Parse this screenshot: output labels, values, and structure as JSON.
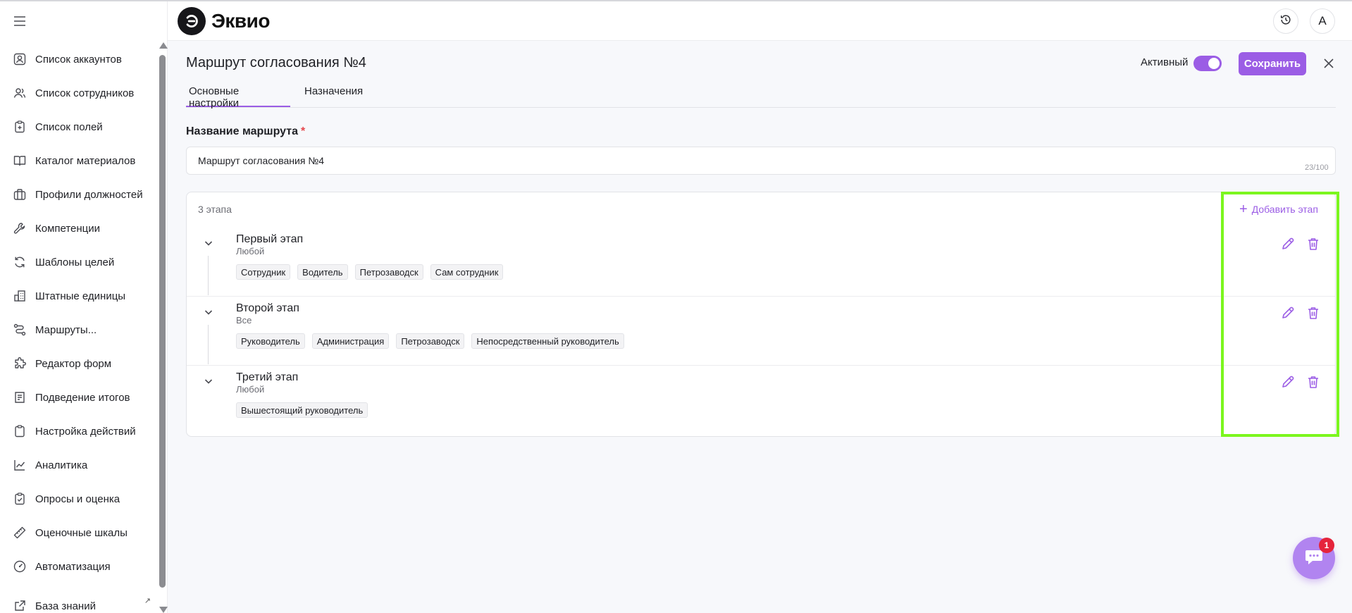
{
  "app": {
    "name": "Эквио"
  },
  "header": {
    "avatar_letter": "А"
  },
  "sidebar": {
    "items": [
      {
        "label": "Список аккаунтов",
        "icon": "account-card-icon"
      },
      {
        "label": "Список сотрудников",
        "icon": "users-icon"
      },
      {
        "label": "Список полей",
        "icon": "clipboard-plus-icon"
      },
      {
        "label": "Каталог материалов",
        "icon": "book-icon"
      },
      {
        "label": "Профили должностей",
        "icon": "briefcase-icon"
      },
      {
        "label": "Компетенции",
        "icon": "wrench-icon"
      },
      {
        "label": "Шаблоны целей",
        "icon": "refresh-icon"
      },
      {
        "label": "Штатные единицы",
        "icon": "buildings-icon"
      },
      {
        "label": "Маршруты...",
        "icon": "route-icon"
      },
      {
        "label": "Редактор форм",
        "icon": "puzzle-icon"
      },
      {
        "label": "Подведение итогов",
        "icon": "document-list-icon"
      },
      {
        "label": "Настройка действий",
        "icon": "clipboard-icon"
      },
      {
        "label": "Аналитика",
        "icon": "chart-line-icon"
      },
      {
        "label": "Опросы и оценка",
        "icon": "clipboard-check-icon"
      },
      {
        "label": "Оценочные шкалы",
        "icon": "ruler-icon"
      },
      {
        "label": "Автоматизация",
        "icon": "gauge-icon"
      },
      {
        "label": "База знаний",
        "icon": "external-link-icon"
      }
    ]
  },
  "page": {
    "title": "Маршрут согласования №4",
    "active_label": "Активный",
    "active": true,
    "save_label": "Сохранить",
    "tabs": [
      {
        "label": "Основные настройки",
        "active": true
      },
      {
        "label": "Назначения",
        "active": false
      }
    ],
    "name_field": {
      "label": "Название маршрута",
      "required_mark": "*",
      "value": "Маршрут согласования №4",
      "counter": "23/100"
    }
  },
  "stages": {
    "count_label": "3 этапа",
    "add_label": "Добавить этап",
    "items": [
      {
        "name": "Первый этап",
        "mode": "Любой",
        "tags": [
          "Сотрудник",
          "Водитель",
          "Петрозаводск",
          "Сам сотрудник"
        ]
      },
      {
        "name": "Второй этап",
        "mode": "Все",
        "tags": [
          "Руководитель",
          "Администрация",
          "Петрозаводск",
          "Непосредственный руководитель"
        ]
      },
      {
        "name": "Третий этап",
        "mode": "Любой",
        "tags": [
          "Вышестоящий руководитель"
        ]
      }
    ]
  },
  "chat": {
    "badge": "1"
  },
  "colors": {
    "accent": "#9b5de5",
    "highlight": "#7cf61e",
    "badge": "#e5243b"
  }
}
